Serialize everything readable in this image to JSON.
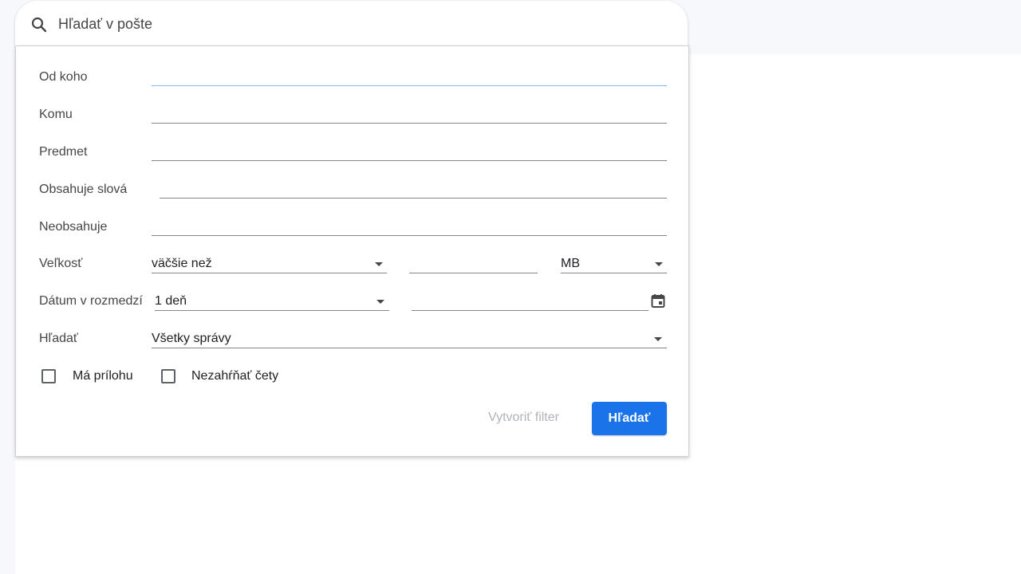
{
  "search": {
    "placeholder": "Hľadať v pošte"
  },
  "form": {
    "from_label": "Od koho",
    "to_label": "Komu",
    "subject_label": "Predmet",
    "has_words_label": "Obsahuje slová",
    "doesnt_have_label": "Neobsahuje",
    "size_label": "Veľkosť",
    "size_operator": "väčšie než",
    "size_unit": "MB",
    "date_label": "Dátum v rozmedzí",
    "date_range": "1 deň",
    "search_in_label": "Hľadať",
    "search_in_value": "Všetky správy",
    "has_attachment_label": "Má prílohu",
    "exclude_chats_label": "Nezahŕňať čety"
  },
  "actions": {
    "create_filter_label": "Vytvoriť filter",
    "search_label": "Hľadať"
  },
  "colors": {
    "primary": "#1a73e8",
    "focus_line": "#8ab4f8",
    "disabled_text": "#b0b3b8"
  }
}
